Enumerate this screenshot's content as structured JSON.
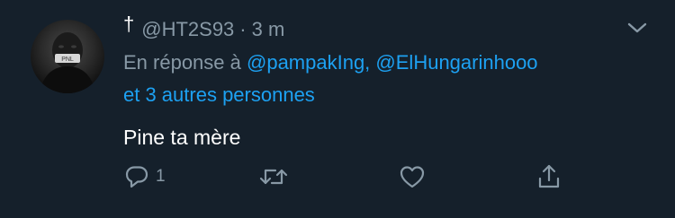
{
  "tweet": {
    "display_name": "†",
    "handle": "@HT2S93",
    "separator": "·",
    "time": "3 m",
    "reply_prefix": "En réponse à",
    "mentions": [
      "@pampakIng,",
      "@ElHungarinhooo"
    ],
    "reply_others": "et 3 autres personnes",
    "text": "Pine ta mère",
    "reply_count": "1"
  },
  "colors": {
    "background": "#15202b",
    "secondary_text": "#8899a6",
    "link": "#1da1f2",
    "primary_text": "#ffffff"
  },
  "icons": {
    "menu": "chevron-down-icon",
    "reply": "reply-bubble-icon",
    "retweet": "retweet-icon",
    "like": "heart-icon",
    "share": "share-icon"
  }
}
